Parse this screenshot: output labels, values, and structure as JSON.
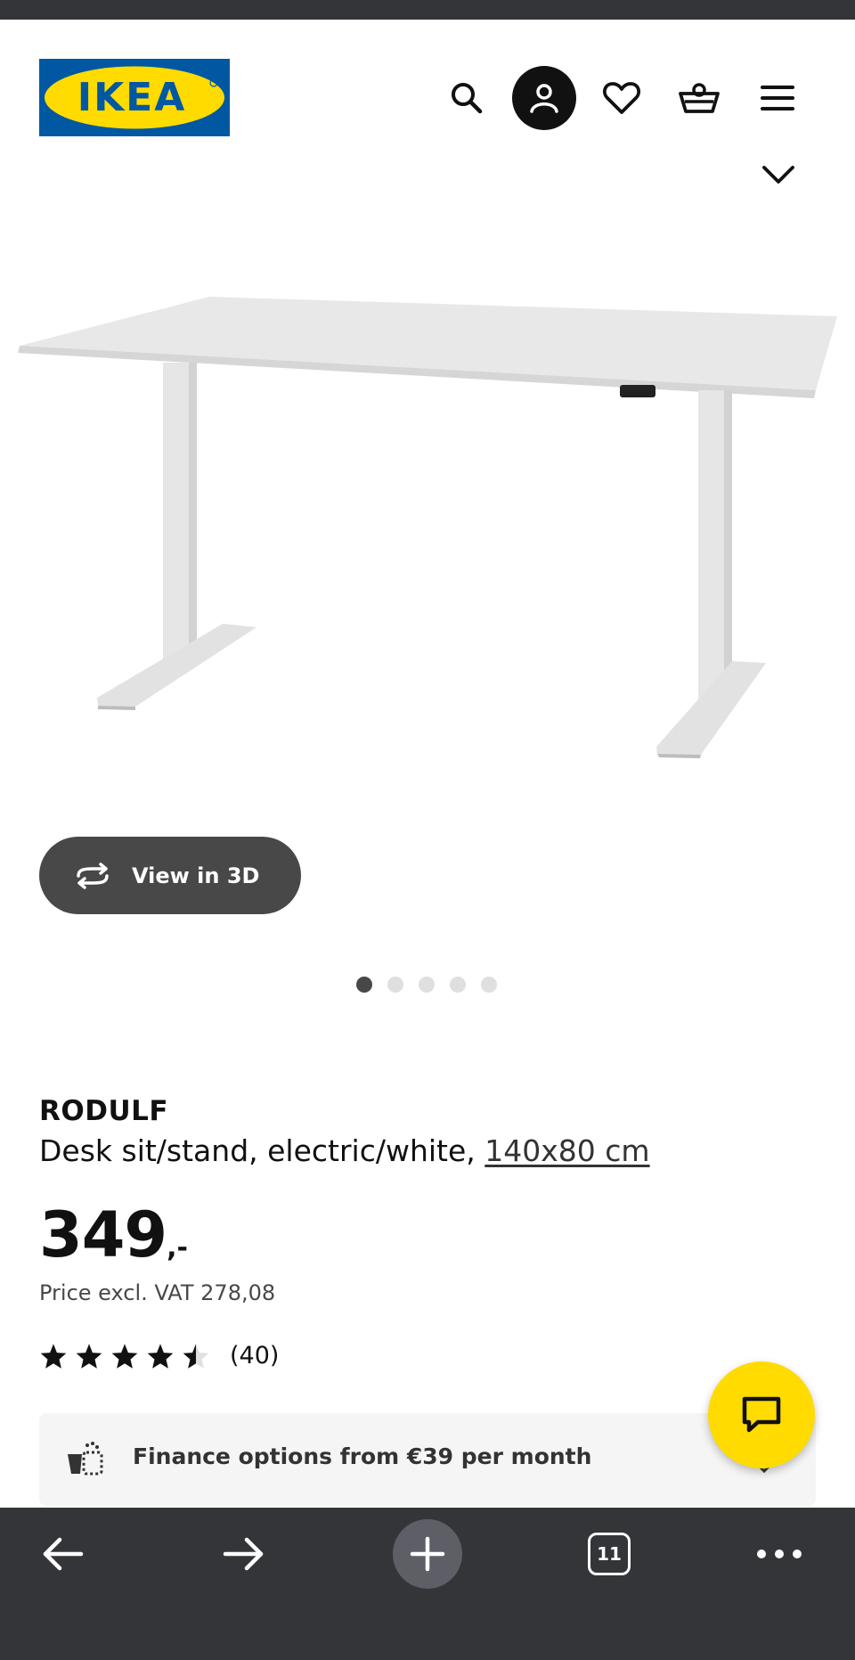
{
  "brand": {
    "logo_text": "IKEA",
    "blue": "#0058a3",
    "yellow": "#ffdb00"
  },
  "header": {
    "icons": [
      "search-icon",
      "user-icon",
      "heart-icon",
      "basket-icon",
      "menu-icon"
    ],
    "expand_icon": "chevron-down-icon"
  },
  "gallery": {
    "view3d_label": "View in 3D",
    "view3d_icon": "rotate-3d-icon",
    "image_count": 5,
    "active_index": 0
  },
  "product": {
    "name": "RODULF",
    "description": "Desk sit/stand, electric/white, ",
    "size": "140x80 cm",
    "price": "349",
    "price_suffix": ",-",
    "vat_text": "Price excl. VAT 278,08",
    "rating": 4.5,
    "review_count": "(40)"
  },
  "finance": {
    "text": "Finance options from €39 per month",
    "icon": "finance-icon"
  },
  "chat": {
    "icon": "chat-icon",
    "color": "#ffdb00"
  },
  "browser": {
    "tab_count": "11",
    "icons": [
      "back-arrow-icon",
      "forward-arrow-icon",
      "plus-icon",
      "tabs-icon",
      "more-icon"
    ],
    "bar_color": "#343538"
  }
}
